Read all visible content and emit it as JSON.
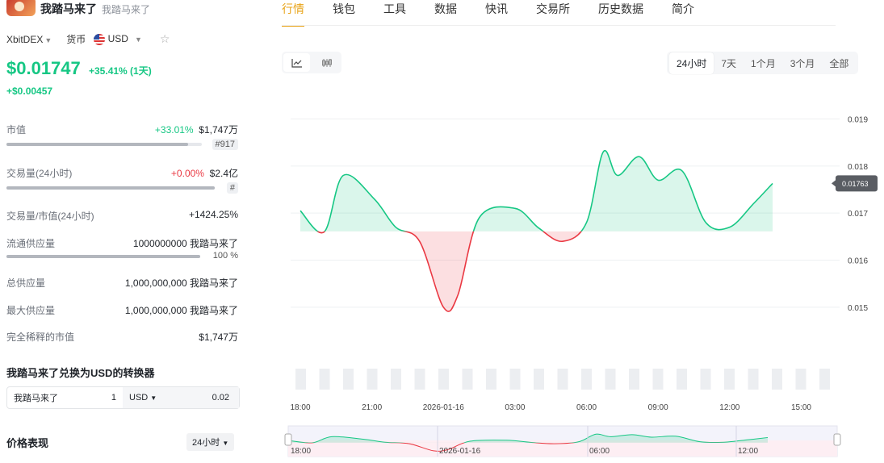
{
  "token": {
    "name": "我踏马来了",
    "subtitle": "我踏马来了"
  },
  "selectors": {
    "exchange": "XbitDEX",
    "currency_label": "货币",
    "currency": "USD"
  },
  "price": {
    "value": "$0.01747",
    "change": "+35.41% (1天)",
    "abs_change": "+$0.00457"
  },
  "stats": {
    "market_cap": {
      "label": "市值",
      "pct": "+33.01%",
      "value": "$1,747万",
      "rank": "#917",
      "bar_fill": 0.93
    },
    "volume": {
      "label": "交易量(24小时)",
      "pct": "+0.00%",
      "value": "$2.4亿",
      "rank": "#",
      "bar_fill": 1.0
    },
    "vol_mcap": {
      "label": "交易量/市值(24小时)",
      "value": "+1424.25%"
    },
    "circulating": {
      "label": "流通供应量",
      "value": "1000000000 我踏马来了",
      "pct": "100 %",
      "bar_fill": 1.0
    },
    "total": {
      "label": "总供应量",
      "value": "1,000,000,000 我踏马来了"
    },
    "max": {
      "label": "最大供应量",
      "value": "1,000,000,000 我踏马来了"
    },
    "fdv": {
      "label": "完全稀释的市值",
      "value": "$1,747万"
    }
  },
  "converter": {
    "title": "我踏马来了兑换为USD的转换器",
    "from_symbol": "我踏马来了",
    "from_amount": "1",
    "to_currency": "USD",
    "to_amount": "0.02"
  },
  "performance": {
    "title": "价格表现",
    "period": "24小时"
  },
  "tabs": [
    "行情",
    "钱包",
    "工具",
    "数据",
    "快讯",
    "交易所",
    "历史数据",
    "简介"
  ],
  "ranges": [
    "24小时",
    "7天",
    "1个月",
    "3个月",
    "全部"
  ],
  "chart_type_icons": [
    "line-chart-icon",
    "candlestick-icon"
  ],
  "colors": {
    "up": "#16c784",
    "down": "#ea3943",
    "accent": "#e8a317"
  },
  "chart_data": {
    "type": "area",
    "baseline": 0.01661,
    "current_label": "0.01763",
    "ylim": [
      0.0145,
      0.0193
    ],
    "y_ticks": [
      0.015,
      0.016,
      0.017,
      0.018,
      0.019
    ],
    "y_tick_labels": [
      "0.015",
      "0.016",
      "0.017",
      "0.018",
      "0.019"
    ],
    "x_tick_labels": [
      "18:00",
      "21:00",
      "2026-01-16",
      "03:00",
      "06:00",
      "09:00",
      "12:00",
      "15:00"
    ],
    "x_tick_hours": [
      0,
      3,
      6,
      9,
      12,
      15,
      18,
      21
    ],
    "series_x_hours": [
      0,
      1,
      1.8,
      3.1,
      4,
      5,
      6,
      6.6,
      7.5,
      9,
      10,
      11,
      12,
      12.7,
      13.3,
      14.2,
      15,
      16,
      17,
      18,
      19,
      19.8,
      21,
      22
    ],
    "series_y": [
      0.01705,
      0.0166,
      0.0178,
      0.0173,
      0.0167,
      0.0164,
      0.015,
      0.01525,
      0.0169,
      0.0171,
      0.01668,
      0.0164,
      0.0168,
      0.0183,
      0.0178,
      0.0182,
      0.0177,
      0.0179,
      0.0168,
      0.0167,
      0.0172,
      0.01763
    ],
    "volume_bars": 23,
    "navigator_labels": [
      "18:00",
      "2026-01-16",
      "06:00",
      "12:00"
    ]
  }
}
